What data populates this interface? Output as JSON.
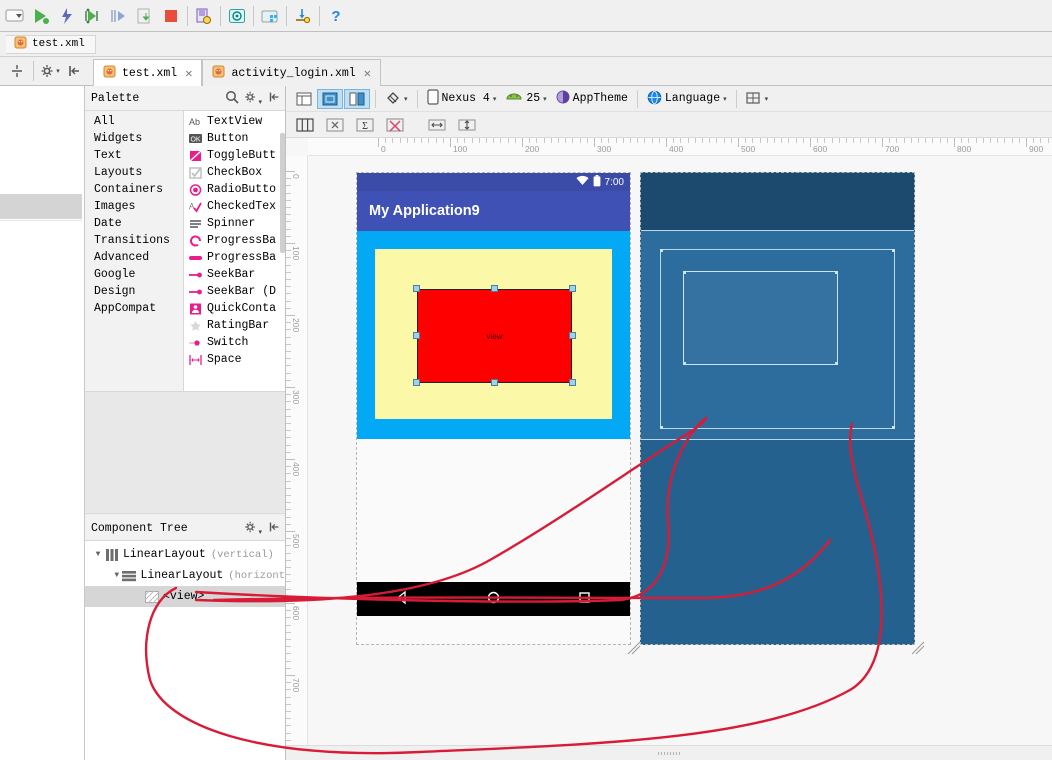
{
  "window": {
    "main_toolbar": [
      {
        "name": "navigation-dropdown-icon",
        "glyph": "▾"
      },
      {
        "name": "run-icon",
        "glyph": "▶"
      },
      {
        "name": "apply-changes-icon",
        "glyph": "⚡"
      },
      {
        "name": "debug-icon",
        "glyph": "🐞"
      },
      {
        "name": "step-over-icon",
        "glyph": "⇥"
      },
      {
        "name": "attach-debugger-icon",
        "glyph": "⬇"
      },
      {
        "name": "stop-icon",
        "glyph": "■"
      },
      {
        "name": "sdk-manager-icon",
        "glyph": "▤"
      },
      {
        "name": "avd-manager-icon",
        "glyph": "◎"
      },
      {
        "name": "project-structure-icon",
        "glyph": "▦"
      },
      {
        "name": "sync-gradle-icon",
        "glyph": "⟳"
      },
      {
        "name": "help-icon",
        "glyph": "?"
      }
    ]
  },
  "breadcrumb": {
    "items": [
      "test.xml"
    ]
  },
  "editor_tabs": {
    "tools": [
      {
        "name": "split-editor-icon",
        "glyph": "÷"
      },
      {
        "name": "settings-gear-icon",
        "glyph": "✿"
      },
      {
        "name": "collapse-all-icon",
        "glyph": "⇤"
      }
    ],
    "tabs": [
      {
        "label": "test.xml",
        "active": true,
        "close": "✕"
      },
      {
        "label": "activity_login.xml",
        "active": false,
        "close": "✕"
      }
    ]
  },
  "palette": {
    "title": "Palette",
    "header_icons": [
      {
        "name": "search-icon",
        "glyph": "⌕"
      },
      {
        "name": "gear-icon",
        "glyph": "✿"
      },
      {
        "name": "collapse-icon",
        "glyph": "⇤"
      }
    ],
    "categories": [
      "All",
      "Widgets",
      "Text",
      "Layouts",
      "Containers",
      "Images",
      "Date",
      "Transitions",
      "Advanced",
      "Google",
      "Design",
      "AppCompat"
    ],
    "items": [
      {
        "label": "TextView",
        "icon": "textview-icon",
        "glyph": "Ab"
      },
      {
        "label": "Button",
        "icon": "button-icon",
        "glyph": "OK"
      },
      {
        "label": "ToggleButt",
        "icon": "togglebutton-icon",
        "glyph": "◧"
      },
      {
        "label": "CheckBox",
        "icon": "checkbox-icon",
        "glyph": "☑"
      },
      {
        "label": "RadioButto",
        "icon": "radiobutton-icon",
        "glyph": "◉"
      },
      {
        "label": "CheckedTex",
        "icon": "checkedtextview-icon",
        "glyph": "A✓"
      },
      {
        "label": "Spinner",
        "icon": "spinner-icon",
        "glyph": "≡"
      },
      {
        "label": "ProgressBa",
        "icon": "progressbar-circular-icon",
        "glyph": "◝"
      },
      {
        "label": "ProgressBa",
        "icon": "progressbar-horizontal-icon",
        "glyph": "▬"
      },
      {
        "label": "SeekBar",
        "icon": "seekbar-icon",
        "glyph": "⇢"
      },
      {
        "label": "SeekBar (D",
        "icon": "seekbar-discrete-icon",
        "glyph": "⇢"
      },
      {
        "label": "QuickConta",
        "icon": "quickcontactbadge-icon",
        "glyph": "👤"
      },
      {
        "label": "RatingBar",
        "icon": "ratingbar-icon",
        "glyph": "★"
      },
      {
        "label": "Switch",
        "icon": "switch-icon",
        "glyph": "⬤"
      },
      {
        "label": "Space",
        "icon": "space-icon",
        "glyph": "|↔|"
      }
    ]
  },
  "component_tree": {
    "title": "Component Tree",
    "header_icons": [
      {
        "name": "gear-icon",
        "glyph": "✿"
      },
      {
        "name": "collapse-icon",
        "glyph": "⇤"
      }
    ],
    "nodes": [
      {
        "label": "LinearLayout",
        "qualifier": "(vertical)",
        "depth": 0,
        "expanded": true,
        "selected": false,
        "icon": "linearlayout-vertical-icon"
      },
      {
        "label": "LinearLayout",
        "qualifier": "(horizont",
        "depth": 1,
        "expanded": true,
        "selected": false,
        "icon": "linearlayout-horizontal-icon"
      },
      {
        "label": "<view>",
        "qualifier": "",
        "depth": 2,
        "expanded": false,
        "selected": true,
        "icon": "view-icon"
      }
    ]
  },
  "design_toolbar": {
    "view_modes": [
      {
        "name": "design-mode-icon",
        "glyph": "▤",
        "active": false
      },
      {
        "name": "blueprint-mode-icon",
        "glyph": "▦",
        "active": true
      },
      {
        "name": "both-mode-icon",
        "glyph": "▥",
        "active": true
      }
    ],
    "orientation": {
      "name": "orientation-icon",
      "glyph": "◇",
      "caret": "▾"
    },
    "device": {
      "label": "Nexus 4",
      "icon": "device-icon",
      "caret": "▾"
    },
    "api_level": {
      "label": "25",
      "icon": "android-icon",
      "caret": "▾"
    },
    "theme": {
      "label": "AppTheme",
      "icon": "theme-icon"
    },
    "language": {
      "label": "Language",
      "icon": "globe-icon",
      "caret": "▾"
    },
    "layout_variants": {
      "name": "layout-variants-icon",
      "glyph": "⊞",
      "caret": "▾"
    },
    "row2": [
      {
        "name": "show-constraints-icon",
        "glyph": "|||"
      },
      {
        "name": "autoconnect-icon",
        "glyph": "⌁"
      },
      {
        "name": "infer-constraints-icon",
        "glyph": "Σ"
      },
      {
        "name": "clear-constraints-icon",
        "glyph": "✖"
      },
      {
        "name": "pack-horizontal-icon",
        "glyph": "↔"
      },
      {
        "name": "pack-vertical-icon",
        "glyph": "↕"
      }
    ]
  },
  "canvas": {
    "ruler_h_labels": [
      "0",
      "100",
      "200",
      "300",
      "400",
      "500",
      "600",
      "700",
      "800",
      "900"
    ],
    "ruler_v_labels": [
      "0",
      "100",
      "200",
      "300",
      "400",
      "500",
      "600",
      "700"
    ],
    "device_preview": {
      "status_time": "7:00",
      "wifi_icon": "wifi-icon",
      "battery_icon": "battery-icon",
      "app_title": "My Application9",
      "selected_view_label": "view",
      "colors": {
        "statusbar": "#3b4ba8",
        "appbar": "#3f51b5",
        "outer_layout": "#03a9f4",
        "inner_layout": "#fbf8a8",
        "selected_view": "#fe0000",
        "navbar": "#000000",
        "handle": "#9fd2e6"
      },
      "nav_buttons": [
        {
          "name": "nav-back-icon",
          "glyph": "◁"
        },
        {
          "name": "nav-home-icon",
          "glyph": "◯"
        },
        {
          "name": "nav-recents-icon",
          "glyph": "▢"
        }
      ]
    },
    "blueprint": {
      "colors": {
        "background": "#24618e",
        "appbar": "#1c4a6e",
        "content": "#2d6d9e",
        "stroke": "#bcd6ea"
      }
    }
  }
}
